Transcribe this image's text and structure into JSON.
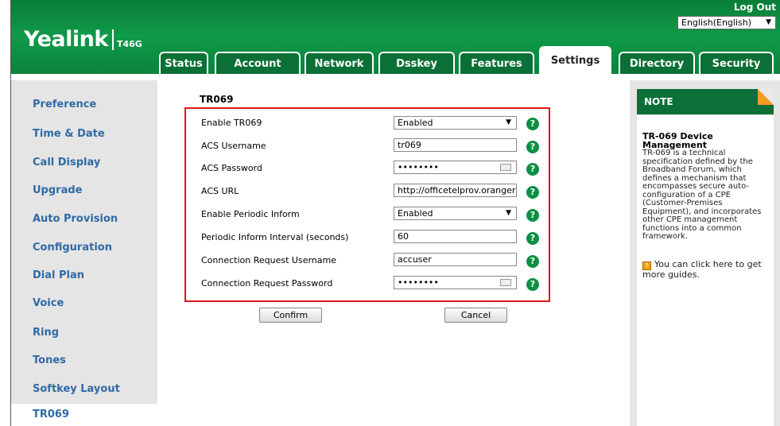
{
  "header": {
    "brand": "Yealink",
    "model": "T46G",
    "logout": "Log Out",
    "language": "English(English)"
  },
  "tabs": [
    "Status",
    "Account",
    "Network",
    "Dsskey",
    "Features",
    "Settings",
    "Directory",
    "Security"
  ],
  "active_tab": "Settings",
  "nav": {
    "items": [
      "Preference",
      "Time & Date",
      "Call Display",
      "Upgrade",
      "Auto Provision",
      "Configuration",
      "Dial Plan",
      "Voice",
      "Ring",
      "Tones",
      "Softkey Layout",
      "TR069"
    ],
    "active": "TR069"
  },
  "form": {
    "title": "TR069",
    "fields": [
      {
        "label": "Enable TR069",
        "value": "Enabled",
        "type": "select"
      },
      {
        "label": "ACS Username",
        "value": "tr069",
        "type": "text"
      },
      {
        "label": "ACS Password",
        "value": "••••••••",
        "type": "password"
      },
      {
        "label": "ACS URL",
        "value": "http://officetelprov.oranger",
        "type": "text"
      },
      {
        "label": "Enable Periodic Inform",
        "value": "Enabled",
        "type": "select"
      },
      {
        "label": "Periodic Inform Interval (seconds)",
        "value": "60",
        "type": "text"
      },
      {
        "label": "Connection Request Username",
        "value": "accuser",
        "type": "text"
      },
      {
        "label": "Connection Request Password",
        "value": "••••••••",
        "type": "password"
      }
    ],
    "help_glyph": "?",
    "confirm": "Confirm",
    "cancel": "Cancel"
  },
  "note": {
    "heading": "NOTE",
    "title": "TR-069 Device Management",
    "body": "TR-069 is a technical specification defined by the Broadband Forum, which defines a mechanism that encompasses secure auto-configuration of a CPE (Customer-Premises Equipment), and incorporates other CPE management functions into a common framework.",
    "guide": "You can click here to get more guides.",
    "guide_icon": "?"
  },
  "colors": {
    "brand_green": "#0e9a48",
    "nav_link": "#2f6aa5",
    "highlight_box": "#e0161b",
    "note_corner": "#f39a21"
  }
}
